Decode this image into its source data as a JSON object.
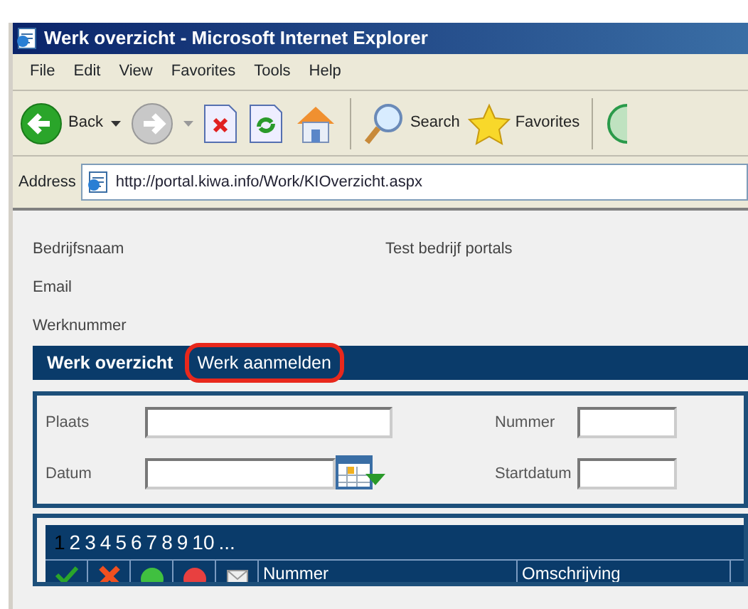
{
  "window": {
    "title": "Werk overzicht - Microsoft Internet Explorer"
  },
  "menu": [
    "File",
    "Edit",
    "View",
    "Favorites",
    "Tools",
    "Help"
  ],
  "toolbar": [
    {
      "kind": "back",
      "label": "Back"
    },
    {
      "kind": "forward"
    },
    {
      "kind": "stop"
    },
    {
      "kind": "refresh"
    },
    {
      "kind": "home"
    },
    {
      "kind": "search",
      "label": "Search"
    },
    {
      "kind": "favorites",
      "label": "Favorites"
    },
    {
      "kind": "media"
    }
  ],
  "address": {
    "label": "Address",
    "url": "http://portal.kiwa.info/Work/KIOverzicht.aspx"
  },
  "info": [
    {
      "label": "Bedrijfsnaam",
      "value": "Test bedrijf portals"
    },
    {
      "label": "Email"
    },
    {
      "label": "Werknummer"
    }
  ],
  "nav": [
    {
      "label": "Werk overzicht",
      "selected": true,
      "highlighted": false
    },
    {
      "label": "Werk aanmelden",
      "selected": false,
      "highlighted": true
    }
  ],
  "filters": [
    {
      "label": "Plaats",
      "kind": "text"
    },
    {
      "label": "Nummer",
      "kind": "text"
    },
    {
      "label": "Datum",
      "kind": "date"
    },
    {
      "label": "Startdatum",
      "kind": "text"
    }
  ],
  "pager": [
    {
      "label": "1",
      "selected": true
    },
    {
      "label": "2",
      "selected": false
    },
    {
      "label": "3",
      "selected": false
    },
    {
      "label": "4",
      "selected": false
    },
    {
      "label": "5",
      "selected": false
    },
    {
      "label": "6",
      "selected": false
    },
    {
      "label": "7",
      "selected": false
    },
    {
      "label": "8",
      "selected": false
    },
    {
      "label": "9",
      "selected": false
    },
    {
      "label": "10",
      "selected": false
    },
    {
      "label": "...",
      "selected": false
    }
  ],
  "table": {
    "icon_columns": [
      {
        "kind": "check"
      },
      {
        "kind": "cross"
      },
      {
        "kind": "green"
      },
      {
        "kind": "red"
      },
      {
        "kind": "mail"
      }
    ],
    "columns": [
      "Nummer",
      "Omschrijving"
    ]
  }
}
